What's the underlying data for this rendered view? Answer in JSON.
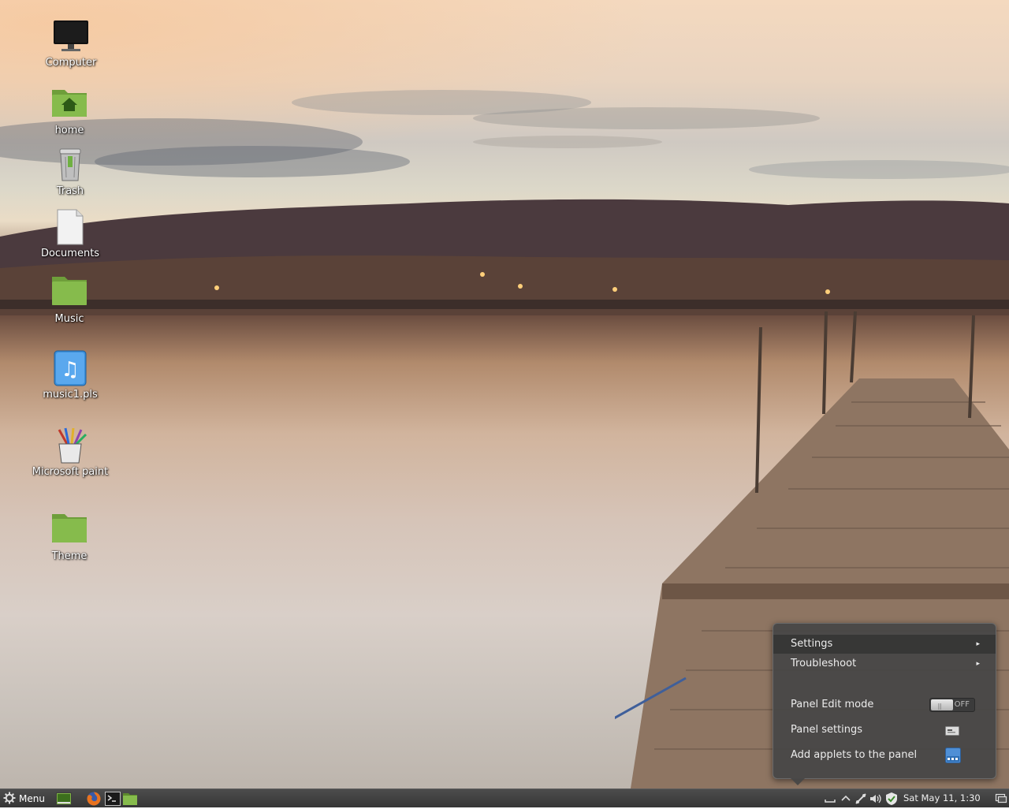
{
  "desktop": {
    "icons": [
      {
        "label": "Computer",
        "icon": "computer-monitor-icon"
      },
      {
        "label": "home",
        "icon": "home-folder-icon"
      },
      {
        "label": "Trash",
        "icon": "trash-icon"
      },
      {
        "label": "Documents",
        "icon": "document-icon"
      },
      {
        "label": "Music",
        "icon": "folder-icon"
      },
      {
        "label": "music1.pls",
        "icon": "music-playlist-icon"
      },
      {
        "label": "Microsoft paint",
        "icon": "paint-app-icon"
      },
      {
        "label": "Theme",
        "icon": "folder-icon"
      }
    ]
  },
  "context_menu": {
    "items": [
      {
        "label": "Settings",
        "has_submenu": true,
        "highlighted": true
      },
      {
        "label": "Troubleshoot",
        "has_submenu": true
      },
      {
        "label": "Panel Edit mode",
        "toggle_state": "OFF"
      },
      {
        "label": "Panel settings",
        "icon": "panel-settings-icon"
      },
      {
        "label": "Add applets to the panel",
        "icon": "applets-icon"
      }
    ],
    "submenu_arrow": "▸"
  },
  "taskbar": {
    "menu_label": "Menu",
    "launchers": [
      "show-desktop-icon",
      "firefox-icon",
      "terminal-icon",
      "files-icon"
    ],
    "tray": [
      "keyboard-icon",
      "chevron-up-icon",
      "network-icon",
      "volume-icon",
      "update-shield-icon"
    ],
    "clock": "Sat May 11,  1:30",
    "trailing_icon": "workspace-icon"
  },
  "colors": {
    "taskbar_bg": "#3f3f3f",
    "menu_bg": "#474747",
    "folder_green": "#7fb347"
  }
}
